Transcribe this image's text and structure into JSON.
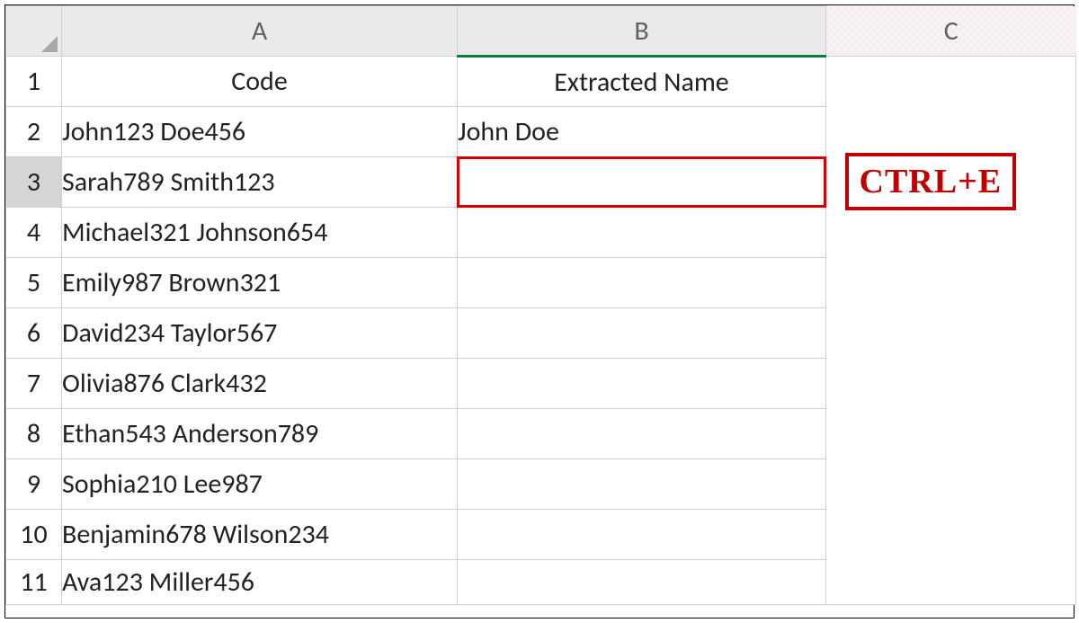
{
  "columns": {
    "A": "A",
    "B": "B",
    "C": "C"
  },
  "row_numbers": [
    "1",
    "2",
    "3",
    "4",
    "5",
    "6",
    "7",
    "8",
    "9",
    "10",
    "11"
  ],
  "headers": {
    "code": "Code",
    "extracted": "Extracted Name"
  },
  "rows": [
    {
      "code": "John123 Doe456",
      "extracted": "John Doe"
    },
    {
      "code": "Sarah789 Smith123",
      "extracted": ""
    },
    {
      "code": "Michael321 Johnson654",
      "extracted": ""
    },
    {
      "code": "Emily987 Brown321",
      "extracted": ""
    },
    {
      "code": "David234 Taylor567",
      "extracted": ""
    },
    {
      "code": "Olivia876 Clark432",
      "extracted": ""
    },
    {
      "code": "Ethan543 Anderson789",
      "extracted": ""
    },
    {
      "code": "Sophia210 Lee987",
      "extracted": ""
    },
    {
      "code": "Benjamin678 Wilson234",
      "extracted": ""
    },
    {
      "code": "Ava123 Miller456",
      "extracted": ""
    }
  ],
  "active_cell": "B3",
  "shortcut_label": "CTRL+E",
  "colors": {
    "header_bg": "#2b5a73",
    "annotation": "#c00000",
    "excel_green": "#107c41"
  }
}
